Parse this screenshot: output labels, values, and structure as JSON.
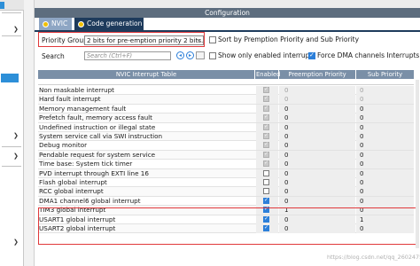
{
  "config_title": "Configuration",
  "tabs": [
    {
      "label": "NVIC"
    },
    {
      "label": "Code generation"
    }
  ],
  "priority_group": {
    "label": "Priority Group",
    "value": "2 bits for pre-emption priority 2 bits..."
  },
  "sort_option": {
    "label": "Sort by Premption Priority and Sub Priority",
    "checked": false
  },
  "search": {
    "label": "Search",
    "placeholder": "Search (Ctrl+F)"
  },
  "show_enabled": {
    "label": "Show only enabled interrupts",
    "checked": false
  },
  "force_dma": {
    "label": "Force DMA channels Interrupts",
    "checked": true
  },
  "table": {
    "headers": [
      "NVIC Interrupt Table",
      "Enabled",
      "Preemption Priority",
      "Sub Priority"
    ],
    "rows": [
      {
        "name": "Non maskable interrupt",
        "enabled": true,
        "locked": true,
        "pp": "0",
        "sp": "0",
        "gray": true
      },
      {
        "name": "Hard fault interrupt",
        "enabled": true,
        "locked": true,
        "pp": "0",
        "sp": "0",
        "gray": true
      },
      {
        "name": "Memory management fault",
        "enabled": true,
        "locked": true,
        "pp": "0",
        "sp": "0",
        "gray": false
      },
      {
        "name": "Prefetch fault, memory access fault",
        "enabled": true,
        "locked": true,
        "pp": "0",
        "sp": "0",
        "gray": false
      },
      {
        "name": "Undefined instruction or illegal state",
        "enabled": true,
        "locked": true,
        "pp": "0",
        "sp": "0",
        "gray": false
      },
      {
        "name": "System service call via SWI instruction",
        "enabled": true,
        "locked": true,
        "pp": "0",
        "sp": "0",
        "gray": false
      },
      {
        "name": "Debug monitor",
        "enabled": true,
        "locked": true,
        "pp": "0",
        "sp": "0",
        "gray": false
      },
      {
        "name": "Pendable request for system service",
        "enabled": true,
        "locked": true,
        "pp": "0",
        "sp": "0",
        "gray": false
      },
      {
        "name": "Time base: System tick timer",
        "enabled": true,
        "locked": true,
        "pp": "0",
        "sp": "0",
        "gray": false
      },
      {
        "name": "PVD interrupt through EXTI line 16",
        "enabled": false,
        "locked": false,
        "pp": "0",
        "sp": "0",
        "gray": false
      },
      {
        "name": "Flash global interrupt",
        "enabled": false,
        "locked": false,
        "pp": "0",
        "sp": "0",
        "gray": false
      },
      {
        "name": "RCC global interrupt",
        "enabled": false,
        "locked": false,
        "pp": "0",
        "sp": "0",
        "gray": false
      },
      {
        "name": "DMA1 channel6 global interrupt",
        "enabled": true,
        "locked": false,
        "pp": "0",
        "sp": "0",
        "gray": false
      },
      {
        "name": "TIM3 global interrupt",
        "enabled": true,
        "locked": false,
        "pp": "1",
        "sp": "0",
        "gray": false
      },
      {
        "name": "USART1 global interrupt",
        "enabled": true,
        "locked": false,
        "pp": "0",
        "sp": "1",
        "gray": false
      },
      {
        "name": "USART2 global interrupt",
        "enabled": true,
        "locked": false,
        "pp": "0",
        "sp": "0",
        "gray": false
      }
    ]
  },
  "watermark": "https://blog.csdn.net/qq_2602475..."
}
